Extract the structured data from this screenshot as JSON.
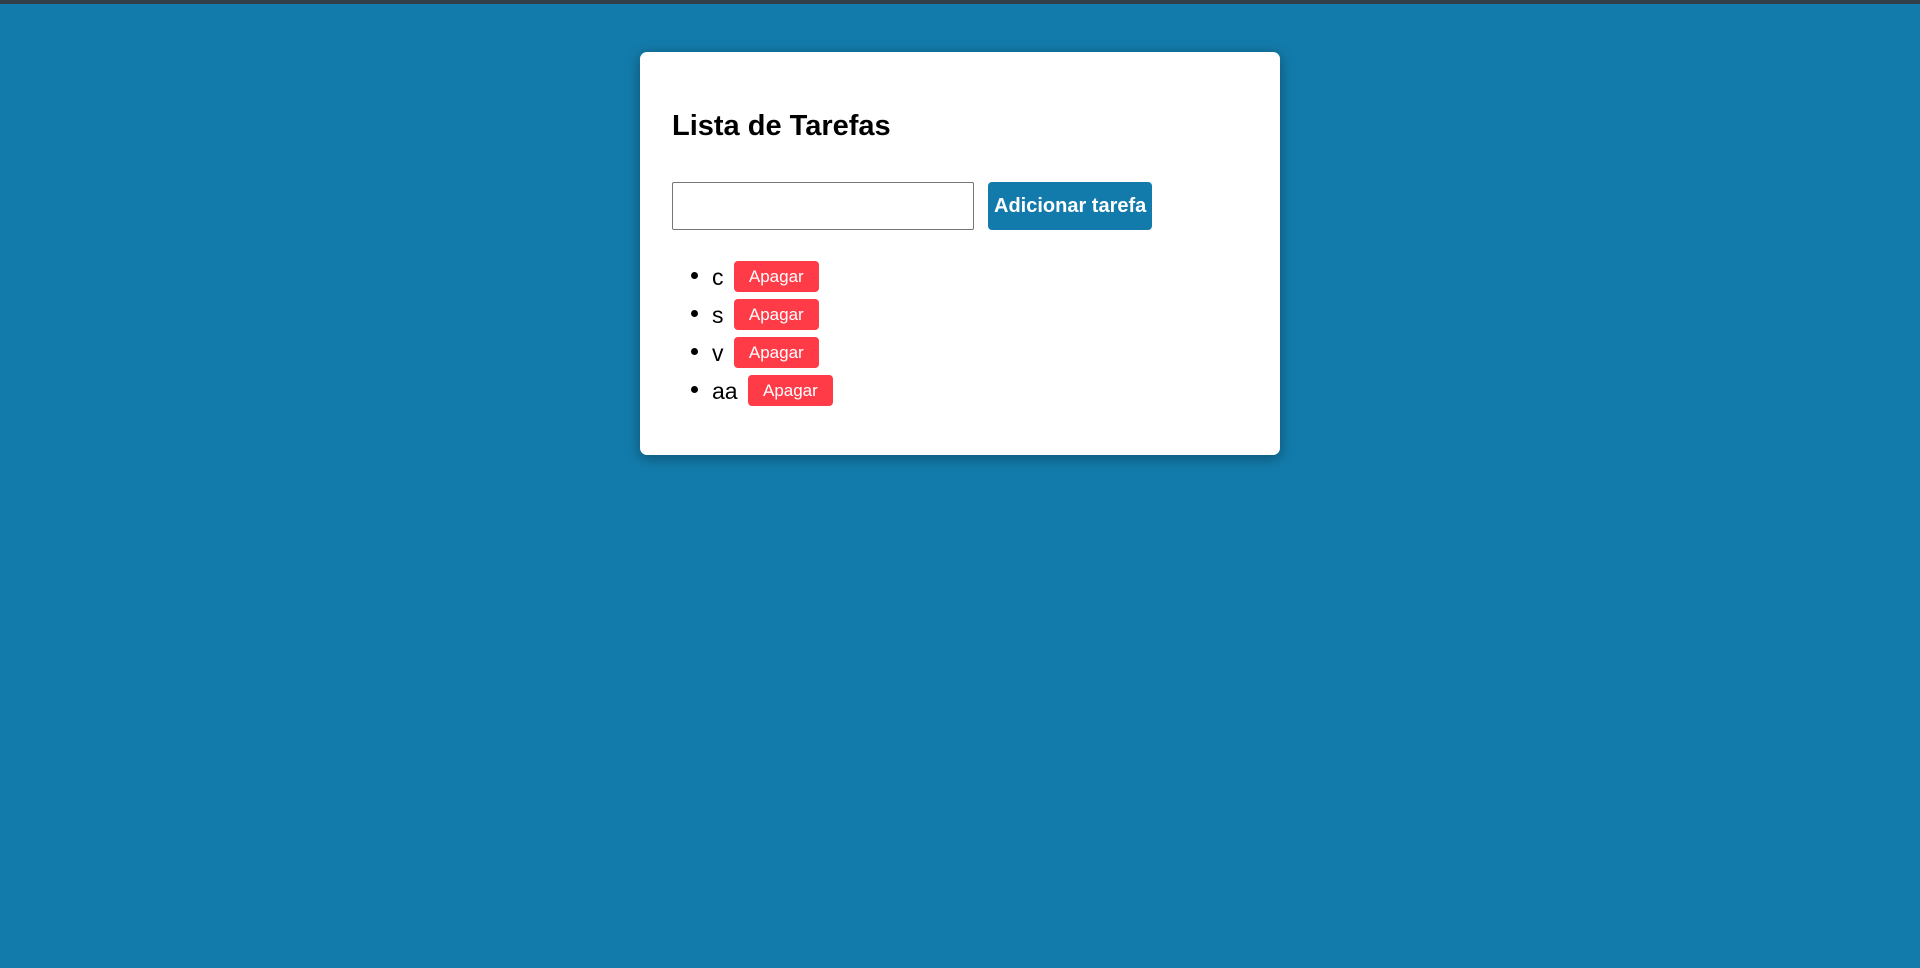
{
  "app": {
    "title": "Lista de Tarefas"
  },
  "form": {
    "input_value": "",
    "input_placeholder": "",
    "add_label": "Adicionar tarefa"
  },
  "tasks": [
    {
      "text": "c",
      "delete_label": "Apagar"
    },
    {
      "text": "s",
      "delete_label": "Apagar"
    },
    {
      "text": "v",
      "delete_label": "Apagar"
    },
    {
      "text": "aa",
      "delete_label": "Apagar"
    }
  ],
  "colors": {
    "background": "#137bab",
    "card": "#ffffff",
    "add_button": "#137bab",
    "delete_button": "#ff3b47",
    "top_strip": "#33404a"
  }
}
